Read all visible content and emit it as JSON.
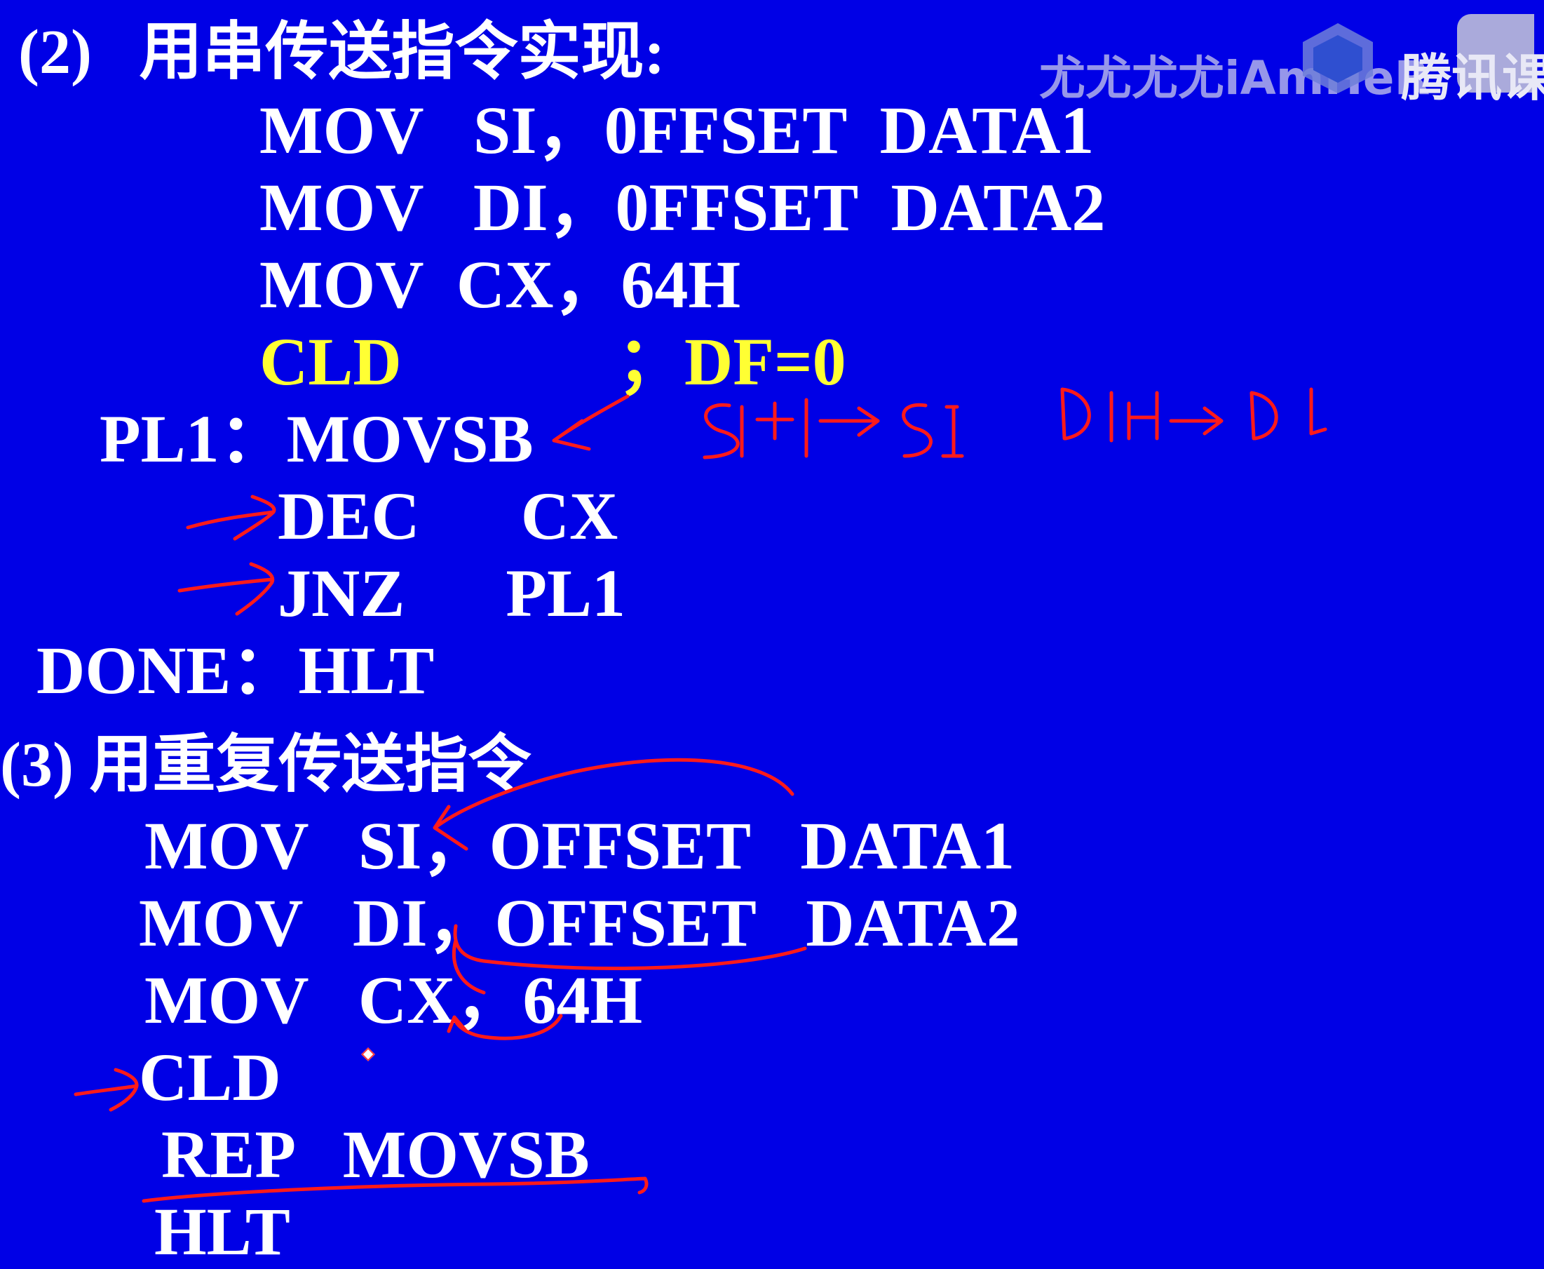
{
  "watermark": {
    "channel": "尤尤尤尤iAmHeR",
    "platform": "腾讯课"
  },
  "section2": {
    "heading": "(2)   用串传送指令实现:",
    "lines": [
      "MOV   SI，0FFSET  DATA1",
      "MOV   DI，0FFSET  DATA2",
      "MOV  CX，64H",
      "PL1：MOVSB",
      "DEC      CX",
      "JNZ      PL1",
      "DONE：HLT"
    ],
    "cld": {
      "instr": "CLD",
      "comment": "；DF=0"
    }
  },
  "section3": {
    "heading": "(3) 用重复传送指令",
    "lines": [
      "MOV   SI，OFFSET   DATA1",
      "MOV   DI，OFFSET   DATA2",
      "MOV   CX，64H",
      "CLD",
      "REP   MOVSB",
      "HLT"
    ]
  },
  "annotation_colors": {
    "ink": "#ff1a1a",
    "comment": "#ffff33",
    "background": "#0000e6"
  }
}
